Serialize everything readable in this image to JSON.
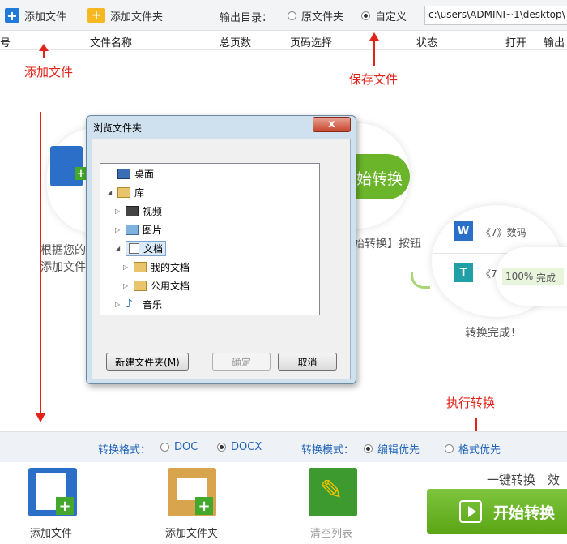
{
  "toolbar": {
    "add_file": "添加文件",
    "add_folder": "添加文件夹",
    "output_dir_label": "输出目录：",
    "opt_source_folder": "原文件夹",
    "opt_custom": "自定义",
    "output_path": "c:\\users\\ADMINI~1\\desktop\\"
  },
  "columns": [
    "编号",
    "文件名称",
    "总页数",
    "页码选择",
    "状态",
    "打开",
    "输出"
  ],
  "annotations": {
    "add_file": "添加文件",
    "save_file": "保存文件",
    "execute": "执行转换"
  },
  "background": {
    "start_convert_partial": "始转换",
    "step1_line1": "根据您的",
    "step1_line2": "添加文件",
    "step2_text": "始转换】按钮",
    "done_text": "转换完成！",
    "file1": "《7》数码",
    "file2": "《7》",
    "progress_percent": "100%",
    "progress_status": "完成"
  },
  "dialog": {
    "title": "浏览文件夹",
    "close": "x",
    "tree": [
      "桌面",
      "库",
      "视频",
      "图片",
      "文档",
      "我的文档",
      "公用文档",
      "音乐"
    ],
    "new_folder": "新建文件夹(M)",
    "ok": "确定",
    "cancel": "取消"
  },
  "options": {
    "format_label": "转换格式：",
    "doc": "DOC",
    "docx": "DOCX",
    "mode_label": "转换模式：",
    "edit_first": "编辑优先",
    "format_first": "格式优先"
  },
  "bottom": {
    "add_file": "添加文件",
    "add_folder": "添加文件夹",
    "clear_list": "清空列表",
    "one_click": "一键转换",
    "efficiency": "效率",
    "start": "开始转换"
  },
  "colors": {
    "accent_blue": "#2164b8",
    "green": "#6bb52a",
    "red": "#e2231a"
  }
}
